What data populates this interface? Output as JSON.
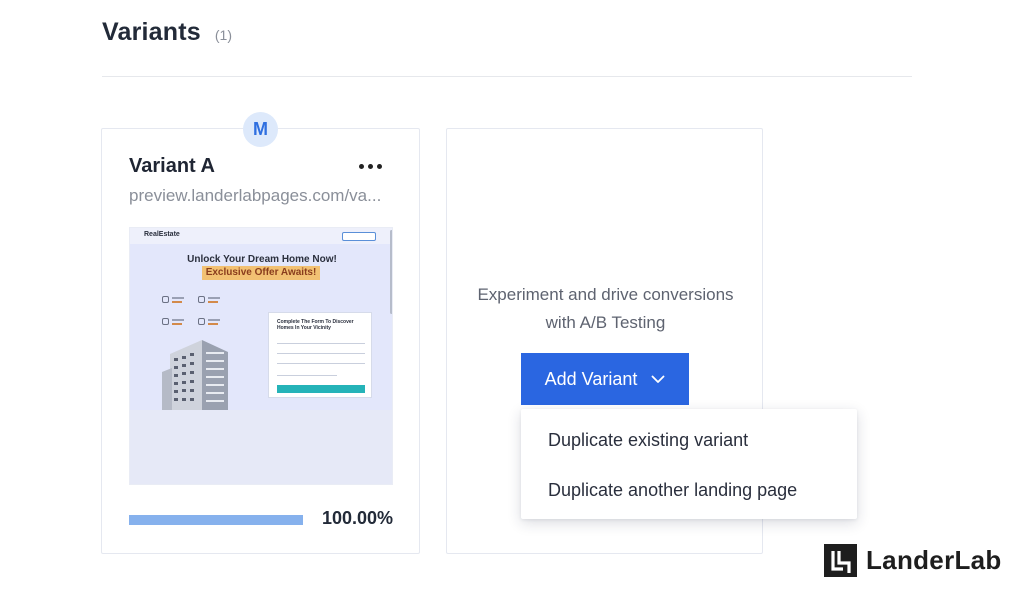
{
  "header": {
    "title": "Variants",
    "count": "(1)"
  },
  "variant_card": {
    "avatar": "M",
    "title": "Variant A",
    "url": "preview.landerlabpages.com/va...",
    "more_icon": "more-horizontal-icon",
    "preview": {
      "logo": "RealEstate",
      "headline": "Unlock Your Dream Home Now!",
      "offer": "Exclusive Offer Awaits!",
      "form_title": "Complete The Form To Discover Homes In Your Vicinity"
    },
    "traffic_percent": "100.00%",
    "traffic_fraction": 1.0
  },
  "add_card": {
    "line1": "Experiment and drive conversions",
    "line2": "with A/B Testing",
    "button_label": "Add Variant",
    "button_icon": "chevron-down-icon"
  },
  "dropdown": {
    "items": [
      "Duplicate existing variant",
      "Duplicate another landing page"
    ]
  },
  "brand": {
    "name": "LanderLab"
  },
  "colors": {
    "accent": "#2a66e1",
    "progress": "#86b1ed",
    "avatar_bg": "#dde9fb"
  }
}
